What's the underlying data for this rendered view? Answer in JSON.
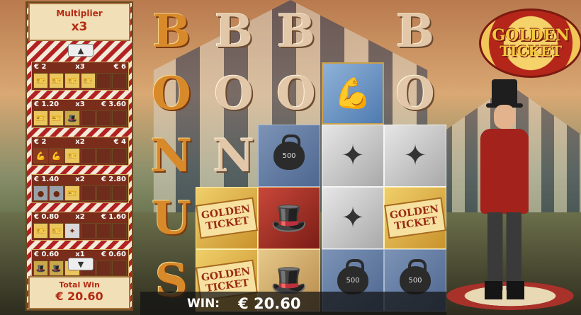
{
  "multiplier": {
    "title": "Multiplier",
    "value": "x3"
  },
  "paytable": {
    "rows": [
      {
        "bet": "€ 2",
        "mult": "x3",
        "win": "€ 6",
        "icons": [
          "ticket",
          "ticket",
          "ticket",
          "ticket",
          "empty",
          "empty"
        ]
      },
      {
        "bet": "€ 1.20",
        "mult": "x3",
        "win": "€ 3.60",
        "icons": [
          "ticket",
          "ticket",
          "ring",
          "empty",
          "empty",
          "empty"
        ]
      },
      {
        "bet": "€ 2",
        "mult": "x2",
        "win": "€ 4",
        "icons": [
          "strong",
          "strong",
          "ticket",
          "empty",
          "empty",
          "empty"
        ]
      },
      {
        "bet": "€ 1.40",
        "mult": "x2",
        "win": "€ 2.80",
        "icons": [
          "weight",
          "weight",
          "ticket",
          "empty",
          "empty",
          "empty"
        ]
      },
      {
        "bet": "€ 0.80",
        "mult": "x2",
        "win": "€ 1.60",
        "icons": [
          "ticket",
          "ticket",
          "club",
          "empty",
          "empty",
          "empty"
        ]
      },
      {
        "bet": "€ 0.60",
        "mult": "x1",
        "win": "€ 0.60",
        "icons": [
          "ring",
          "ring",
          "ticket",
          "empty",
          "empty",
          "empty"
        ]
      }
    ]
  },
  "total": {
    "title": "Total Win",
    "value": "€ 20.60"
  },
  "bonus_letters": {
    "b": "B",
    "o": "O",
    "n": "N",
    "u": "U",
    "s": "S"
  },
  "symbols": {
    "ticket_line1": "GOLDEN",
    "ticket_line2": "TICKET",
    "weight_label": "500"
  },
  "logo": {
    "line1": "GOLDEN",
    "line2": "TICKET"
  },
  "win": {
    "label": "WIN:",
    "value": "€ 20.60"
  }
}
